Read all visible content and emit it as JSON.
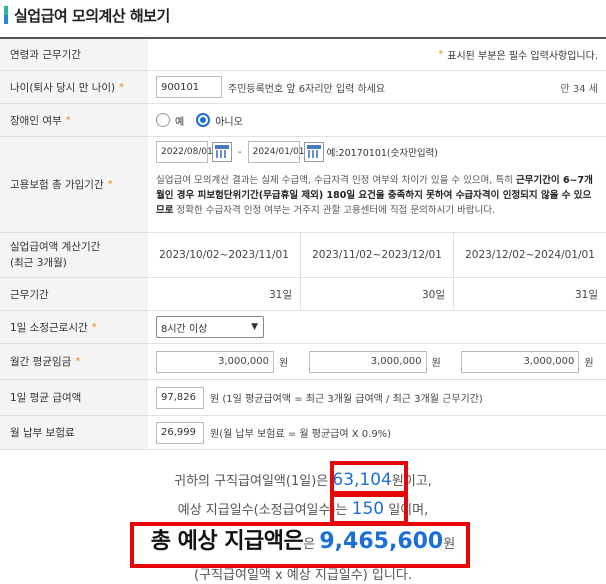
{
  "title": "실업급여 모의계산 해보기",
  "header": {
    "label": "연령과 근무기간",
    "required_note": "표시된 부분은 필수 입력사항입니다.",
    "star": "*"
  },
  "age": {
    "label": "나이(퇴사 당시 만 나이)",
    "value": "900101",
    "hint": "주민등록번호 앞 6자리만 입력 하세요",
    "result": "만 34 세"
  },
  "disability": {
    "label": "장애인 여부",
    "yes": "예",
    "no": "아니오",
    "selected": "no"
  },
  "insurance_period": {
    "label": "고용보험 총 가입기간",
    "start": "2022/08/01",
    "sep": "-",
    "end": "2024/01/01",
    "example": "예:20170101(숫자만입력)",
    "notice_1": "실업급여 모의계산 결과는 실제 수급액, 수급자격 인정 여부와 차이가 있을 수 있으며, 특히 ",
    "notice_bold": "근무기간이 6~7개월인 경우 피보험단위기간(무급휴일 제외) 180일 요건을 충족하지 못하여 수급자격이 인정되지 않을 수 있으므로",
    "notice_2": " 정확한 수급자격 인정 여부는 거주지 관할 고용센터에 직접 문의하시기 바랍니다."
  },
  "calc_period": {
    "label_1": "실업급여액 계산기간",
    "label_2": "(최근 3개월)",
    "periods": [
      "2023/10/02~2023/11/01",
      "2023/11/02~2023/12/01",
      "2023/12/02~2024/01/01"
    ]
  },
  "work_days": {
    "label": "근무기간",
    "values": [
      "31일",
      "30일",
      "31일"
    ]
  },
  "daily_hours": {
    "label": "1일 소정근로시간",
    "selected": "8시간 이상"
  },
  "monthly_wage": {
    "label": "월간 평균임금",
    "values": [
      "3,000,000",
      "3,000,000",
      "3,000,000"
    ],
    "unit": "원"
  },
  "daily_avg": {
    "label": "1일 평균 급여액",
    "value": "97,826",
    "note": "원 (1일 평균급여액 = 최근 3개월 급여액 / 최근 3개월 근무기간)"
  },
  "monthly_premium": {
    "label": "월 납부 보험료",
    "value": "26,999",
    "note": "원(월 납부 보험료 = 월 평균급여 X 0.9%)"
  },
  "summary": {
    "l1_a": "귀하의 구직급여일액(1일)은 ",
    "daily_amount": "63,104",
    "l1_b": "원이고,",
    "l2_a": "예상 지급일수(소정급여일수)는 ",
    "days": "150",
    "l2_b": " 일이며,",
    "l3_a": "총 예상 지급액은",
    "l3_b": "은 ",
    "total": "9,465,600",
    "l3_c": "원",
    "l4": "(구직급여일액 x 예상 지급일수) 입니다."
  },
  "colors": {
    "accent": "#1d6fd8",
    "highlight_box": "#e8050a",
    "required": "#e8891c"
  }
}
